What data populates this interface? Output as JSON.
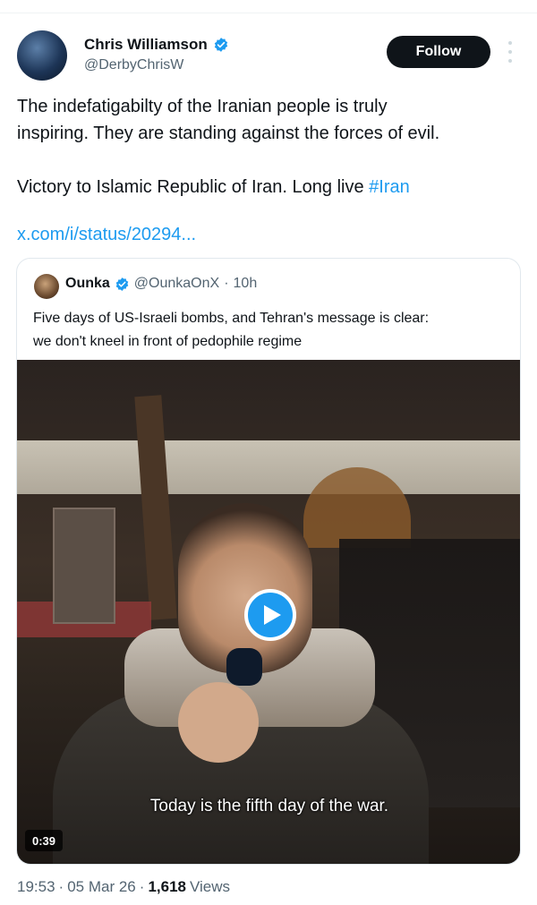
{
  "tweet": {
    "author_name": "Chris Williamson",
    "author_handle": "@DerbyChrisW",
    "follow_label": "Follow",
    "text_line1": "The indefatigabilty of the Iranian people is truly",
    "text_line2": "inspiring. They are standing against the forces of evil.",
    "text_line3_prefix": "Victory to Islamic Republic of Iran. Long live ",
    "hashtag": "#Iran",
    "link": "x.com/i/status/20294..."
  },
  "quote": {
    "author_name": "Ounka",
    "author_handle": "@OunkaOnX",
    "separator": "·",
    "time": "10h",
    "text_line1": "Five days of US-Israeli bombs, and Tehran's message is clear:",
    "text_line2": "we don't kneel in front of pedophile regime",
    "video_subtitle": "Today is the fifth day of the war.",
    "video_duration": "0:39"
  },
  "meta": {
    "time": "19:53",
    "sep1": "·",
    "date": "05 Mar 26",
    "sep2": "·",
    "views_count": "1,618",
    "views_label": "Views"
  },
  "colors": {
    "accent": "#1d9bf0",
    "text": "#0f1419",
    "secondary": "#536471"
  }
}
